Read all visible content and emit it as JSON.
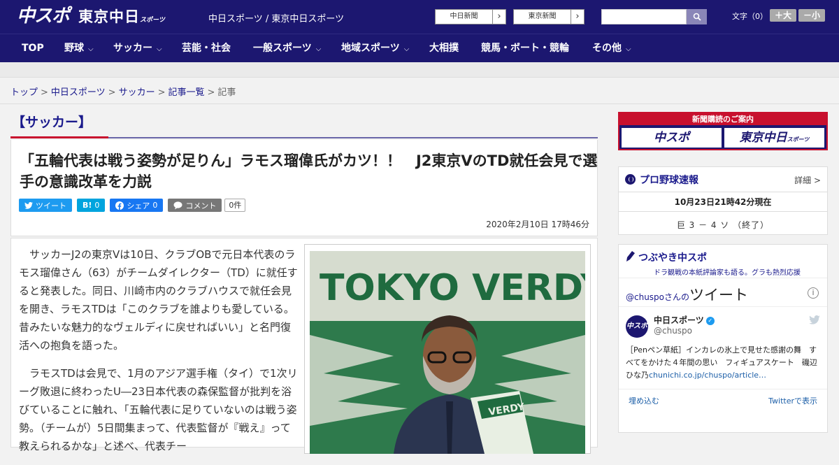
{
  "header": {
    "logo_chuspo": "中スポ",
    "logo_tokyo": "東京中日",
    "logo_tokyo_small": "スポーツ",
    "site_title": "中日スポーツ / 東京中日スポーツ",
    "ext_links": [
      {
        "label": "中日新聞",
        "arrow": "›"
      },
      {
        "label": "東京新聞",
        "arrow": "›"
      }
    ],
    "search_placeholder": "",
    "font_size_label": "文字（0）",
    "font_plus": "＋大",
    "font_minus": "－小"
  },
  "nav": {
    "items": [
      {
        "label": "TOP",
        "chevron": ""
      },
      {
        "label": "野球",
        "chevron": "⌵"
      },
      {
        "label": "サッカー",
        "chevron": "⌵"
      },
      {
        "label": "芸能・社会",
        "chevron": ""
      },
      {
        "label": "一般スポーツ",
        "chevron": "⌵"
      },
      {
        "label": "地域スポーツ",
        "chevron": "⌵"
      },
      {
        "label": "大相撲",
        "chevron": ""
      },
      {
        "label": "競馬・ボート・競輪",
        "chevron": ""
      },
      {
        "label": "その他",
        "chevron": "⌵"
      }
    ]
  },
  "breadcrumb": {
    "items": [
      "トップ",
      "中日スポーツ",
      "サッカー",
      "記事一覧"
    ],
    "current": "記事",
    "separator": ">"
  },
  "article": {
    "category": "【サッカー】",
    "headline": "「五輪代表は戦う姿勢が足りん」ラモス瑠偉氏がカツ！！　J2東京VのTD就任会見で選手の意識改革を力説",
    "share": {
      "tweet": "ツイート",
      "hatena": "B!",
      "hatena_count": "0",
      "facebook": "シェア",
      "facebook_count": "0",
      "comment": "コメント",
      "comment_count": "0件"
    },
    "date": "2020年2月10日 17時46分",
    "paragraphs": [
      "サッカーJ2の東京Vは10日、クラブOBで元日本代表のラモス瑠偉さん（63）がチームダイレクター（TD）に就任すると発表した。同日、川崎市内のクラブハウスで就任会見を開き、ラモスTDは「このクラブを誰よりも愛している。昔みたいな魅力的なヴェルディに戻せればいい」と名門復活への抱負を語った。",
      "ラモスTDは会見で、1月のアジア選手権（タイ）で1次リーグ敗退に終わったU―23日本代表の森保監督が批判を浴びていることに触れ、「五輪代表に足りていないのは戦う姿勢。（チームが）5日間集まって、代表監督が『戦え』って教えられるかな」と述べ、代表チー"
    ],
    "photo_banner_text": "TOKYO VERDY",
    "photo_scarf_text": "VERDY"
  },
  "sidebar": {
    "subscribe": {
      "header": "新聞購読のご案内",
      "logo1": "中スポ",
      "logo2": "東京中日",
      "logo2_small": "スポーツ"
    },
    "baseball": {
      "title": "プロ野球速報",
      "more": "詳細 >",
      "time": "10月23日21時42分現在",
      "score": "巨 3 － 4 ソ （終了）"
    },
    "tsubuyaki": {
      "title": "つぶやき中スポ",
      "subtitle": "ドラ観戦の本紙評論家も語る。グラも熱烈応援",
      "account": "@chuspo",
      "account_suffix": "さんの",
      "timeline_label": "ツイート",
      "info": "i",
      "tweet": {
        "avatar": "中スポ",
        "name": "中日スポーツ",
        "handle": "@chuspo",
        "text": "［Penペン草紙］インカレの氷上で見せた感謝の舞　すべてをかけた４年間の思い　フィギュアスケート　磯辺ひな乃",
        "link": "chunichi.co.jp/chuspo/article…"
      },
      "embed": "埋め込む",
      "view_on_twitter": "Twitterで表示"
    }
  },
  "colors": {
    "brand_navy": "#1c1770",
    "accent_red": "#c8102e",
    "twitter_blue": "#1d9bf0",
    "facebook_blue": "#1877f2",
    "hatena_blue": "#00a4de",
    "comment_gray": "#777777"
  }
}
